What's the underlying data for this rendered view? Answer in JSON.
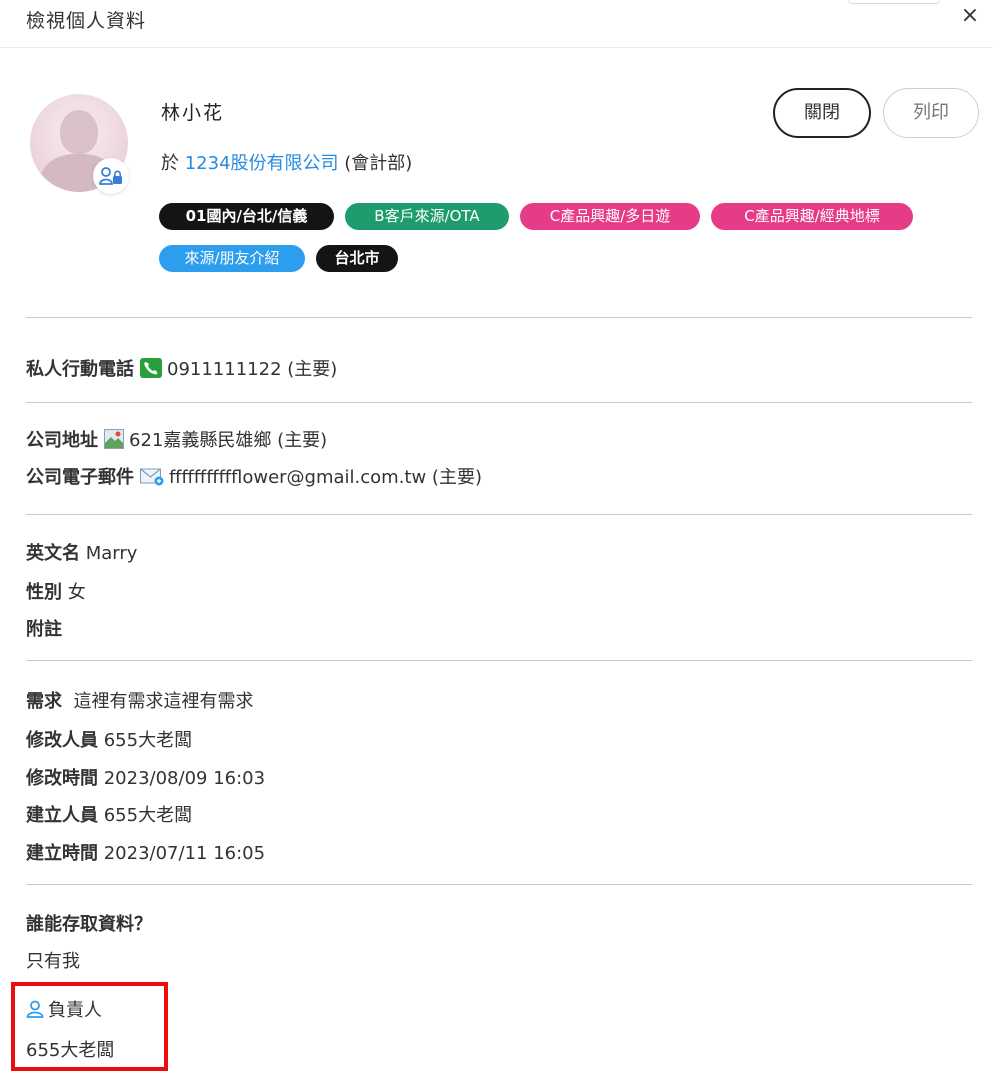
{
  "header": {
    "title": "檢視個人資料",
    "close_icon": "×"
  },
  "profile": {
    "name": "林小花",
    "company_prefix": "於",
    "company": "1234股份有限公司",
    "department": "(會計部)",
    "avatar_icon": "user-lock-icon"
  },
  "buttons": {
    "close": "關閉",
    "print": "列印"
  },
  "tags": [
    {
      "label": "01國內/台北/信義",
      "color": "#141414"
    },
    {
      "label": "B客戶來源/OTA",
      "color": "#1e9c6e"
    },
    {
      "label": "C產品興趣/多日遊",
      "color": "#e63b86"
    },
    {
      "label": "C產品興趣/經典地標",
      "color": "#e63b86"
    },
    {
      "label": "來源/朋友介紹",
      "color": "#2d9ded"
    },
    {
      "label": "台北市",
      "color": "#141414"
    }
  ],
  "phone": {
    "label": "私人行動電話",
    "icon": "phone-icon",
    "value": "0911111122 (主要)"
  },
  "address": {
    "label": "公司地址",
    "icon": "map-icon",
    "value": "621嘉義縣民雄鄉 (主要)"
  },
  "email": {
    "label": "公司電子郵件",
    "icon": "mail-icon",
    "value": "ffffffffffflower@gmail.com.tw (主要)"
  },
  "details": [
    {
      "label": "英文名",
      "value": "Marry"
    },
    {
      "label": "性別",
      "value": "女"
    },
    {
      "label": "附註",
      "value": ""
    }
  ],
  "meta": [
    {
      "label": "需求",
      "value": "這裡有需求這裡有需求"
    },
    {
      "label": "修改人員",
      "value": "655大老闆"
    },
    {
      "label": "修改時間",
      "value": "2023/08/09 16:03"
    },
    {
      "label": "建立人員",
      "value": "655大老闆"
    },
    {
      "label": "建立時間",
      "value": "2023/07/11 16:05"
    }
  ],
  "access": {
    "question": "誰能存取資料？",
    "answer": "只有我",
    "owner_label": "負責人",
    "owner_icon": "person-icon",
    "owner_name": "655大老闆"
  },
  "colors": {
    "accent": "#2a8ae0",
    "highlight": "#ee0b0b"
  }
}
